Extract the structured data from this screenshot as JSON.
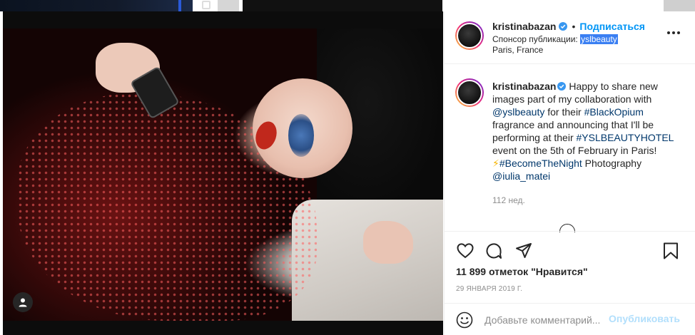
{
  "header": {
    "username": "kristinabazan",
    "dot": "•",
    "follow_label": "Подписаться",
    "sponsor_prefix": "Спонсор публикации: ",
    "sponsor_name": "yslbeauty",
    "location": "Paris, France"
  },
  "caption": {
    "username": "kristinabazan",
    "text_1": " Happy to share new images part of my collaboration with ",
    "mention_1": "@yslbeauty",
    "text_2": " for their ",
    "hashtag_1": "#BlackOpium",
    "text_3": " fragrance and announcing that I'll be performing at their ",
    "hashtag_2": "#YSLBEAUTYHOTEL",
    "text_4": " event on the 5th of February in Paris! ",
    "emoji": "⚡",
    "hashtag_3": "#BecomeTheNight",
    "text_5": " Photography ",
    "mention_2": "@iulia_matei",
    "time": "112 нед."
  },
  "actions": {
    "likes": "11 899 отметок \"Нравится\"",
    "date": "29 ЯНВАРЯ 2019 Г.",
    "comment_placeholder": "Добавьте комментарий...",
    "publish_label": "Опубликовать"
  },
  "colors": {
    "accent": "#0095f6",
    "link": "#00376b",
    "muted": "#8e8e8e",
    "text": "#262626",
    "selection": "#3a7ff2"
  },
  "icons": [
    "verified-badge-icon",
    "more-options-icon",
    "load-more-comments-icon",
    "heart-icon",
    "comment-icon",
    "share-icon",
    "save-bookmark-icon",
    "emoji-icon",
    "user-tag-icon",
    "carousel-icon"
  ]
}
